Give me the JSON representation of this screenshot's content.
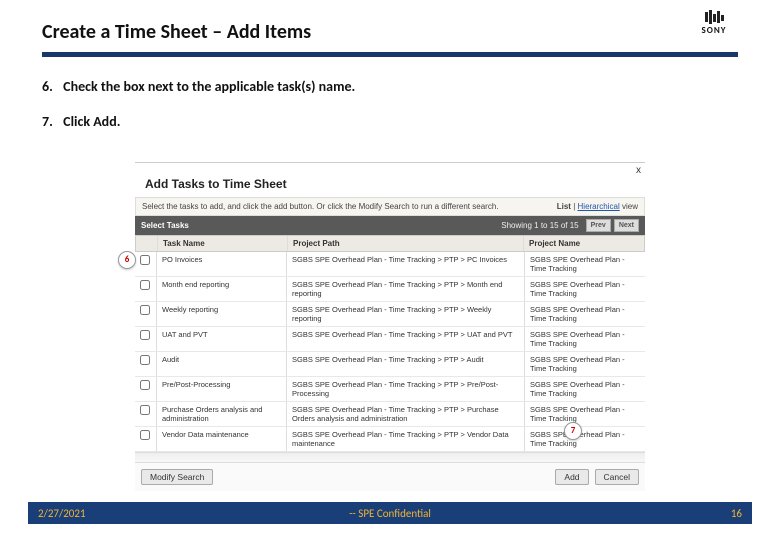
{
  "title": "Create a Time Sheet – Add Items",
  "logo": {
    "brand": "SONY"
  },
  "steps": [
    {
      "num": "6.",
      "text": "Check the box next to the applicable task(s) name."
    },
    {
      "num": "7.",
      "text": "Click Add."
    }
  ],
  "callouts": {
    "c6": "6",
    "c7": "7"
  },
  "dialog": {
    "title": "Add Tasks to Time Sheet",
    "instruction": "Select the tasks to add, and click the add button. Or click the Modify Search to run a different search.",
    "view_label_list": "List",
    "view_label_hier": "Hierarchical",
    "view_suffix": " view",
    "section_label": "Select Tasks",
    "pager_count": "Showing 1 to 15 of 15",
    "prev": "Prev",
    "next": "Next",
    "columns": {
      "task_name": "Task Name",
      "project_path": "Project Path",
      "project_name": "Project Name"
    },
    "rows": [
      {
        "task": "PO Invoices",
        "path": "SGBS SPE Overhead Plan - Time Tracking > PTP > PC Invoices",
        "proj": "SGBS SPE Overhead Plan - Time Tracking"
      },
      {
        "task": "Month end reporting",
        "path": "SGBS SPE Overhead Plan - Time Tracking > PTP > Month end reporting",
        "proj": "SGBS SPE Overhead Plan - Time Tracking"
      },
      {
        "task": "Weekly reporting",
        "path": "SGBS SPE Overhead Plan - Time Tracking > PTP > Weekly reporting",
        "proj": "SGBS SPE Overhead Plan - Time Tracking"
      },
      {
        "task": "UAT and PVT",
        "path": "SGBS SPE Overhead Plan - Time Tracking > PTP > UAT and PVT",
        "proj": "SGBS SPE Overhead Plan - Time Tracking"
      },
      {
        "task": "Audit",
        "path": "SGBS SPE Overhead Plan - Time Tracking > PTP > Audit",
        "proj": "SGBS SPE Overhead Plan - Time Tracking"
      },
      {
        "task": "Pre/Post-Processing",
        "path": "SGBS SPE Overhead Plan - Time Tracking > PTP > Pre/Post-Processing",
        "proj": "SGBS SPE Overhead Plan - Time Tracking"
      },
      {
        "task": "Purchase Orders analysis and administration",
        "path": "SGBS SPE Overhead Plan - Time Tracking > PTP > Purchase Orders analysis and administration",
        "proj": "SGBS SPE Overhead Plan - Time Tracking"
      },
      {
        "task": "Vendor Data maintenance",
        "path": "SGBS SPE Overhead Plan - Time Tracking > PTP > Vendor Data maintenance",
        "proj": "SGBS SPE Overhead Plan - Time Tracking"
      }
    ],
    "modify_search": "Modify Search",
    "add": "Add",
    "cancel": "Cancel",
    "close_x": "x"
  },
  "footer": {
    "date": "2/27/2021",
    "confidential": "-- SPE Confidential",
    "page": "16"
  }
}
